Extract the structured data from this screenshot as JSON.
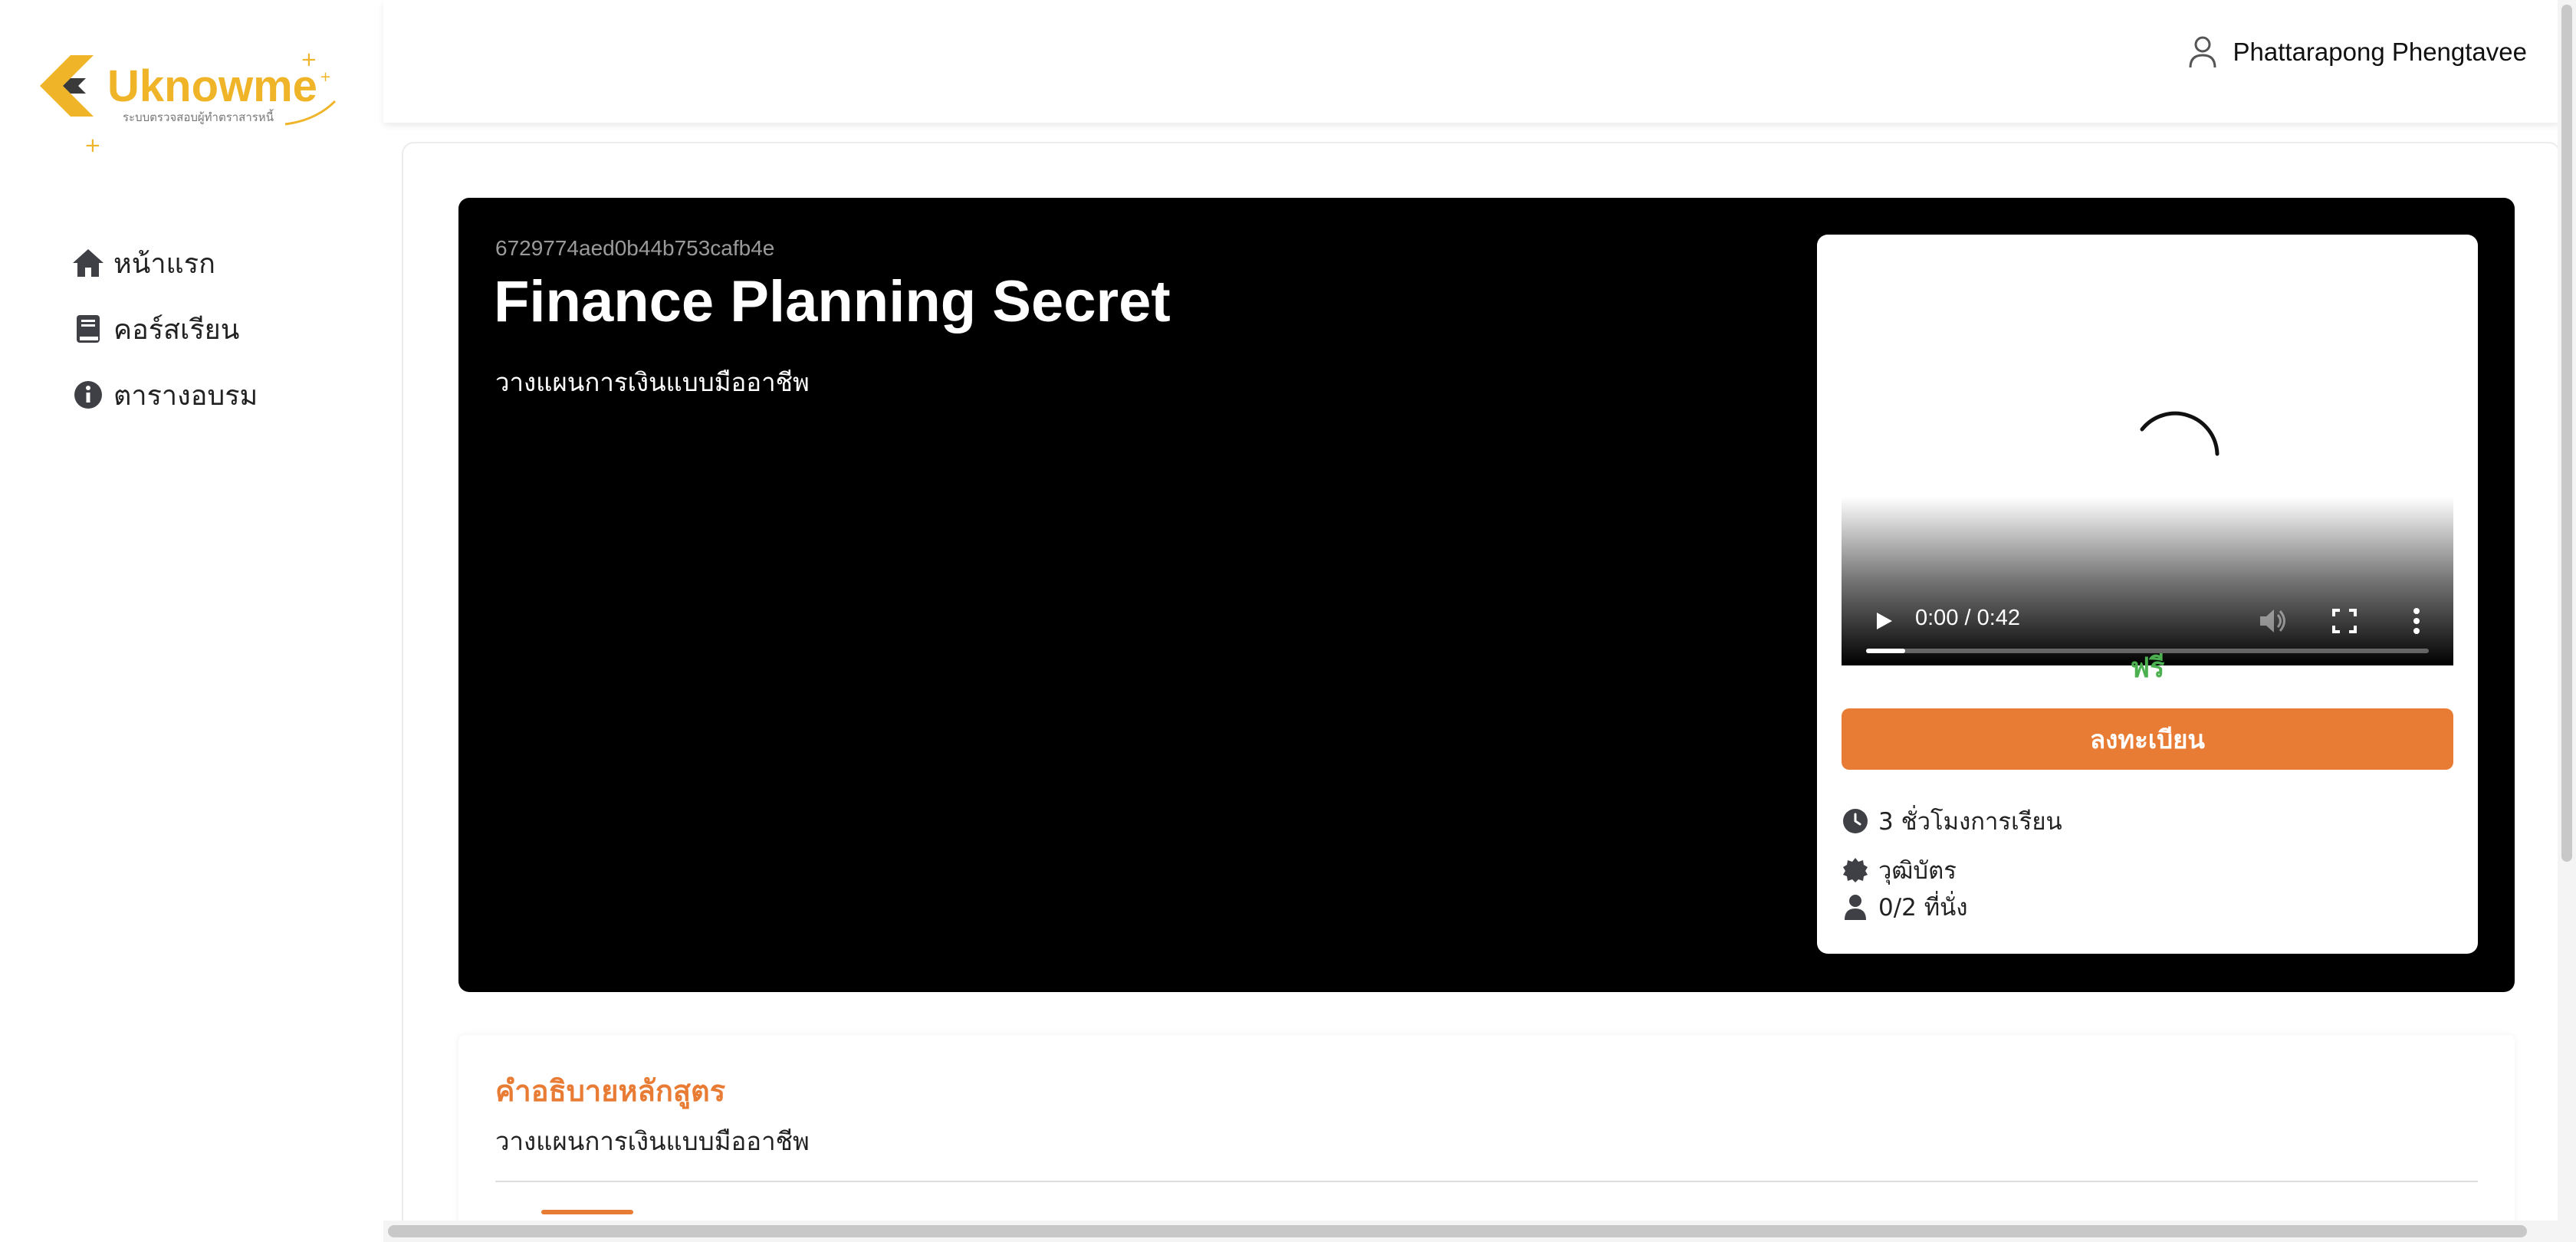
{
  "brand": {
    "name": "Uknowme",
    "tagline": "ระบบตรวจสอบผู้ทำตราสารหนี้",
    "color": "#f0b429"
  },
  "sidebar": {
    "items": [
      {
        "label": "หน้าแรก",
        "icon": "home-icon"
      },
      {
        "label": "คอร์สเรียน",
        "icon": "book-icon"
      },
      {
        "label": "ตารางอบรม",
        "icon": "info-icon"
      }
    ]
  },
  "header": {
    "user_name": "Phattarapong Phengtavee",
    "user_icon": "user-icon"
  },
  "course": {
    "id": "6729774aed0b44b753cafb4e",
    "title": "Finance Planning Secret",
    "subtitle": "วางแผนการเงินแบบมืออาชีพ"
  },
  "video": {
    "time": "0:00 / 0:42",
    "progress": 0.07
  },
  "panel": {
    "price": "ฟรี",
    "price_color": "#4caf50",
    "enroll_label": "ลงทะเบียน",
    "enroll_color": "#e97c35",
    "hours": "3 ชั่วโมงการเรียน",
    "certificate": "วุฒิบัตร",
    "seats": "0/2 ที่นั่ง"
  },
  "description": {
    "title": "คำอธิบายหลักสูตร",
    "text": "วางแผนการเงินแบบมืออาชีพ"
  }
}
